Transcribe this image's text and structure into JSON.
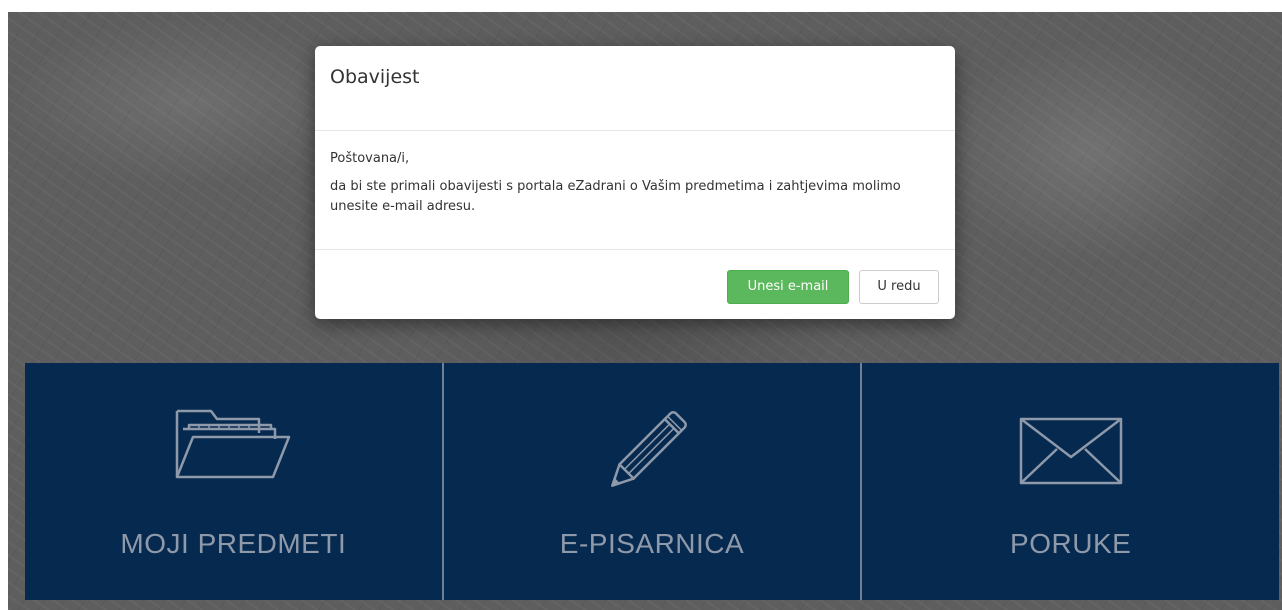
{
  "modal": {
    "title": "Obavijest",
    "greeting": "Poštovana/i,",
    "message": "da bi ste primali obavijesti s portala eZadrani o Vašim predmetima i zahtjevima molimo unesite e-mail adresu.",
    "primary_button": "Unesi e-mail",
    "secondary_button": "U redu"
  },
  "tiles": [
    {
      "label": "MOJI PREDMETI",
      "icon": "folder-icon"
    },
    {
      "label": "E-PISARNICA",
      "icon": "pencil-icon"
    },
    {
      "label": "PORUKE",
      "icon": "envelope-icon"
    }
  ],
  "colors": {
    "tile_background": "#06294f",
    "tile_text": "#8e99aa",
    "primary_button": "#5cb85c"
  }
}
